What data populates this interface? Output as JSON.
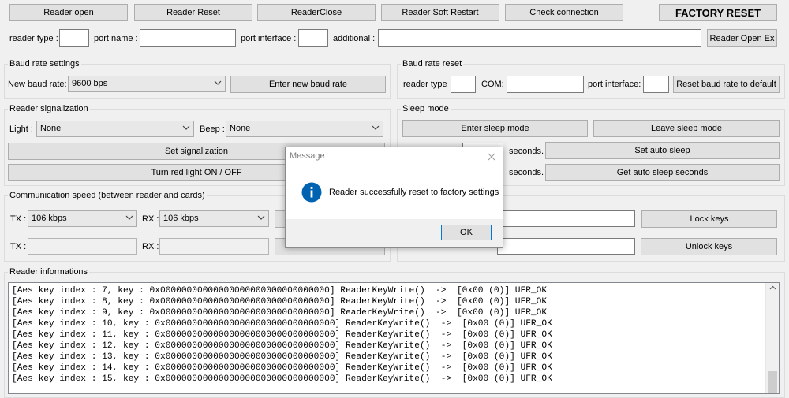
{
  "top_buttons": {
    "reader_open": "Reader open",
    "reader_reset": "Reader Reset",
    "reader_close": "ReaderClose",
    "soft_restart": "Reader Soft Restart",
    "check_connection": "Check connection",
    "factory_reset": "FACTORY RESET"
  },
  "open_ex": {
    "reader_type_label": "reader type :",
    "reader_type_value": "",
    "port_name_label": "port name :",
    "port_name_value": "",
    "port_interface_label": "port interface :",
    "port_interface_value": "",
    "additional_label": "additional :",
    "additional_value": "",
    "button": "Reader Open Ex"
  },
  "baud_settings": {
    "title": "Baud rate settings",
    "new_baud_label": "New baud rate:",
    "new_baud_value": "9600 bps",
    "enter_button": "Enter new baud rate"
  },
  "baud_reset": {
    "title": "Baud rate reset",
    "reader_type_label": "reader type",
    "com_label": "COM:",
    "port_interface_label": "port interface:",
    "button": "Reset baud rate to default"
  },
  "signalization": {
    "title": "Reader signalization",
    "light_label": "Light :",
    "light_value": "None",
    "beep_label": "Beep :",
    "beep_value": "None",
    "set_button": "Set signalization",
    "red_light_button": "Turn red light ON / OFF"
  },
  "sleep": {
    "title": "Sleep mode",
    "enter_button": "Enter sleep mode",
    "leave_button": "Leave sleep mode",
    "seconds_label_1": "seconds.",
    "set_auto_button": "Set auto sleep",
    "seconds_label_2": "seconds.",
    "get_auto_button": "Get auto sleep seconds"
  },
  "comm_speed": {
    "title": "Communication speed (between reader and cards)",
    "tx_label": "TX :",
    "tx_value": "106 kbps",
    "rx_label": "RX :",
    "rx_value": "106 kbps",
    "tx_label_2": "TX :",
    "rx_label_2": "RX :"
  },
  "keys": {
    "lock_button": "Lock keys",
    "unlock_button": "Unlock keys"
  },
  "info": {
    "title": "Reader informations",
    "log": [
      "[Aes key index : 7, key : 0x00000000000000000000000000000000] ReaderKeyWrite()  ->  [0x00 (0)] UFR_OK",
      "[Aes key index : 8, key : 0x00000000000000000000000000000000] ReaderKeyWrite()  ->  [0x00 (0)] UFR_OK",
      "[Aes key index : 9, key : 0x00000000000000000000000000000000] ReaderKeyWrite()  ->  [0x00 (0)] UFR_OK",
      "[Aes key index : 10, key : 0x00000000000000000000000000000000] ReaderKeyWrite()  ->  [0x00 (0)] UFR_OK",
      "[Aes key index : 11, key : 0x00000000000000000000000000000000] ReaderKeyWrite()  ->  [0x00 (0)] UFR_OK",
      "[Aes key index : 12, key : 0x00000000000000000000000000000000] ReaderKeyWrite()  ->  [0x00 (0)] UFR_OK",
      "[Aes key index : 13, key : 0x00000000000000000000000000000000] ReaderKeyWrite()  ->  [0x00 (0)] UFR_OK",
      "[Aes key index : 14, key : 0x00000000000000000000000000000000] ReaderKeyWrite()  ->  [0x00 (0)] UFR_OK",
      "[Aes key index : 15, key : 0x00000000000000000000000000000000] ReaderKeyWrite()  ->  [0x00 (0)] UFR_OK"
    ]
  },
  "dialog": {
    "title": "Message",
    "message": "Reader successfully reset to factory settings",
    "ok_button": "OK",
    "icon": "info-icon",
    "icon_color": "#0063b1"
  }
}
